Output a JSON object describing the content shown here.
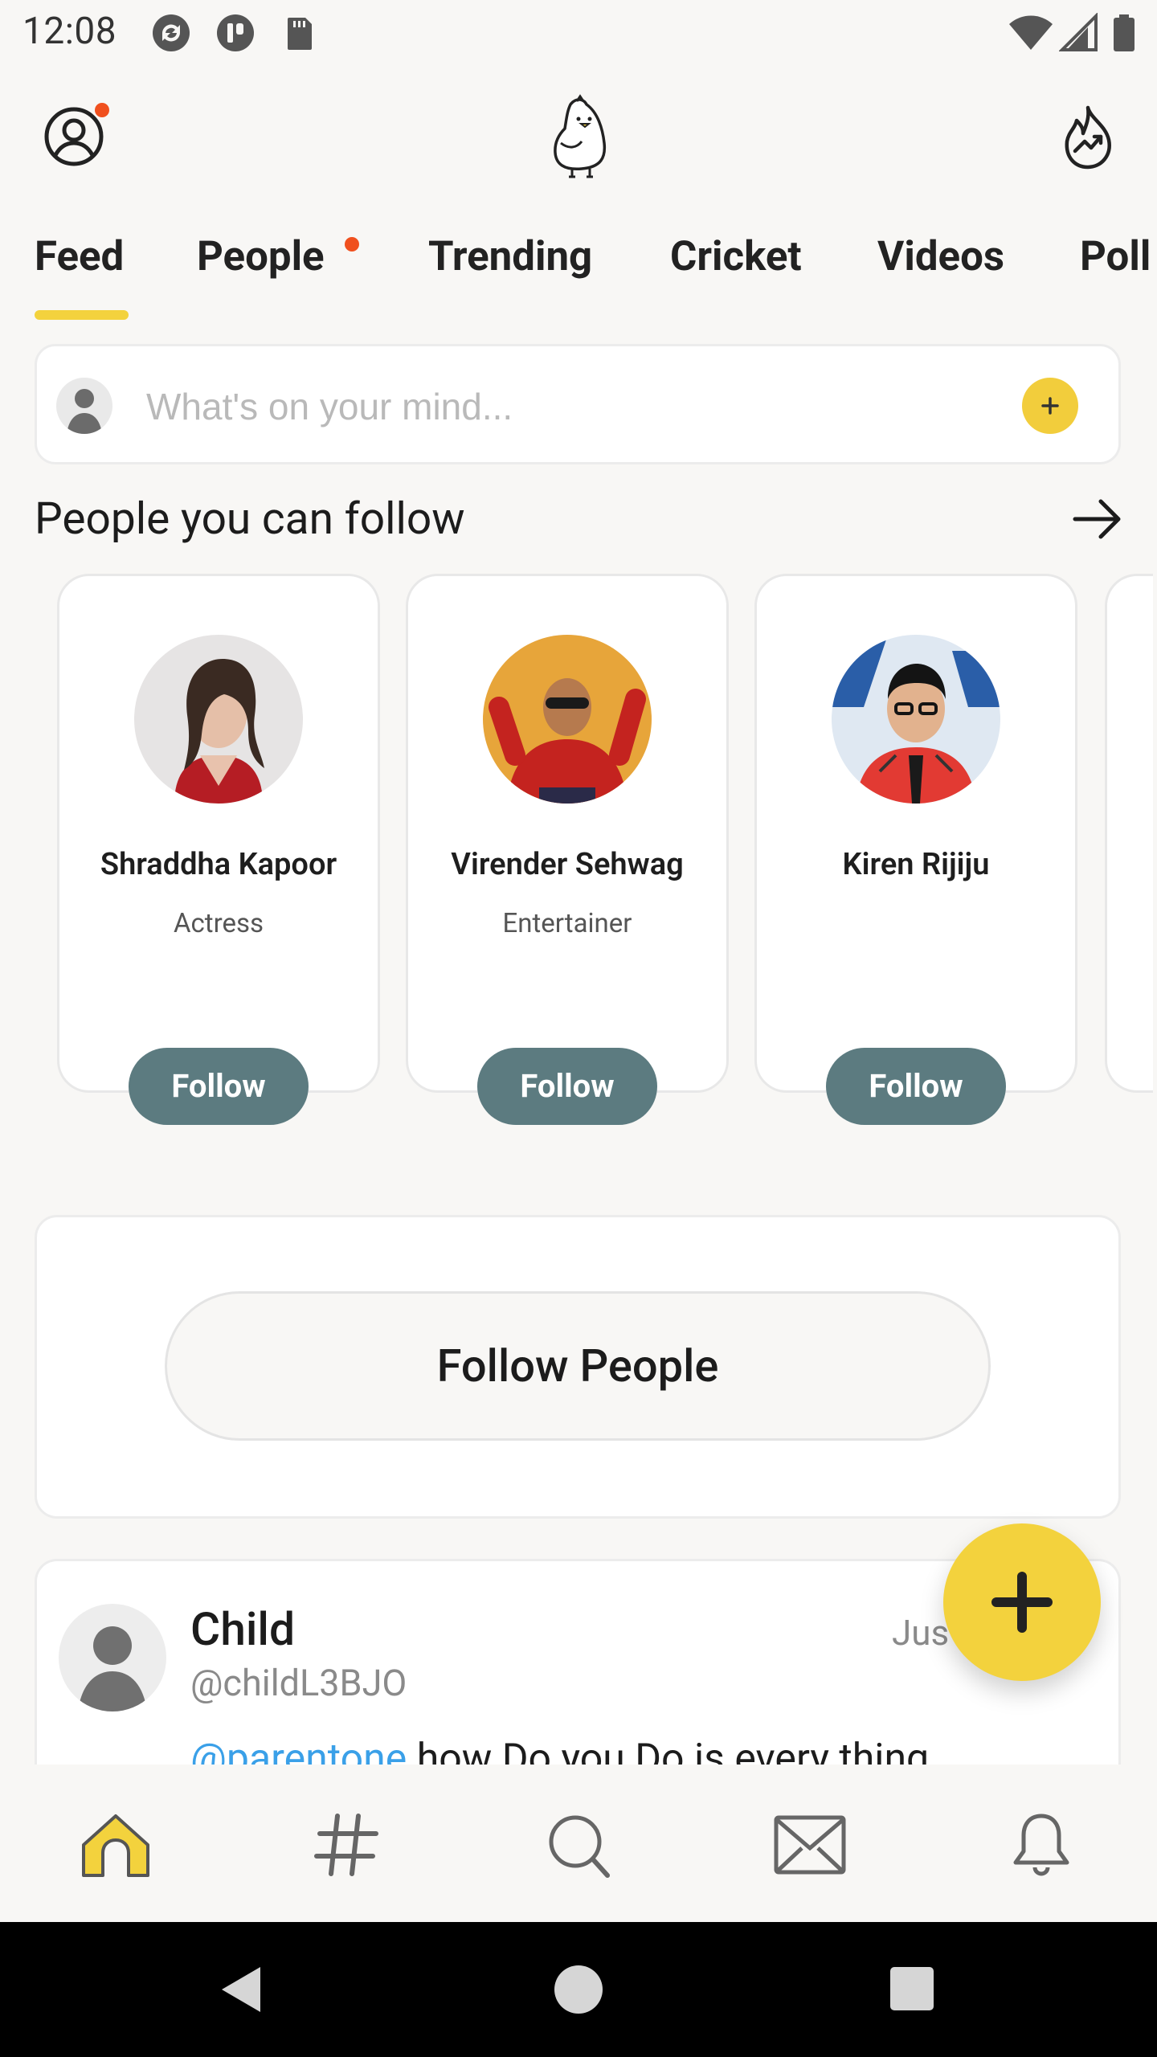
{
  "status_bar": {
    "time": "12:08",
    "left_icons": [
      "sync-icon",
      "app-icon",
      "sd-card-icon"
    ],
    "right_icons": [
      "wifi-icon",
      "cell-signal-icon",
      "battery-icon"
    ]
  },
  "header": {
    "profile_icon": "user-circle-icon",
    "has_profile_notification": true,
    "logo_icon": "koo-bird-logo",
    "trending_icon": "trending-flame-icon"
  },
  "tabs": [
    {
      "label": "Feed",
      "active": true
    },
    {
      "label": "People",
      "has_dot": true
    },
    {
      "label": "Trending"
    },
    {
      "label": "Cricket"
    },
    {
      "label": "Videos"
    },
    {
      "label": "Poll"
    }
  ],
  "composer": {
    "placeholder": "What's on your mind..."
  },
  "suggestions": {
    "title": "People you can follow",
    "people": [
      {
        "name": "Shraddha Kapoor",
        "role": "Actress",
        "follow_label": "Follow"
      },
      {
        "name": "Virender Sehwag",
        "role": "Entertainer",
        "follow_label": "Follow"
      },
      {
        "name": "Kiren Rijiju",
        "role": "",
        "follow_label": "Follow"
      }
    ]
  },
  "follow_people": {
    "button_label": "Follow People"
  },
  "post": {
    "author_name": "Child",
    "handle": "@childL3BJO",
    "time": "Jus",
    "mention": "@parentone",
    "text": " how Do you Do is every thing"
  },
  "bottom_nav": [
    {
      "icon": "home-icon",
      "active": true
    },
    {
      "icon": "hashtag-icon"
    },
    {
      "icon": "search-icon"
    },
    {
      "icon": "mail-icon"
    },
    {
      "icon": "bell-icon"
    }
  ],
  "colors": {
    "accent_yellow": "#f3d23d",
    "follow_button": "#5c7b80",
    "notification_dot": "#f0501e",
    "mention_blue": "#3aa0e8",
    "background": "#f8f7f5"
  }
}
